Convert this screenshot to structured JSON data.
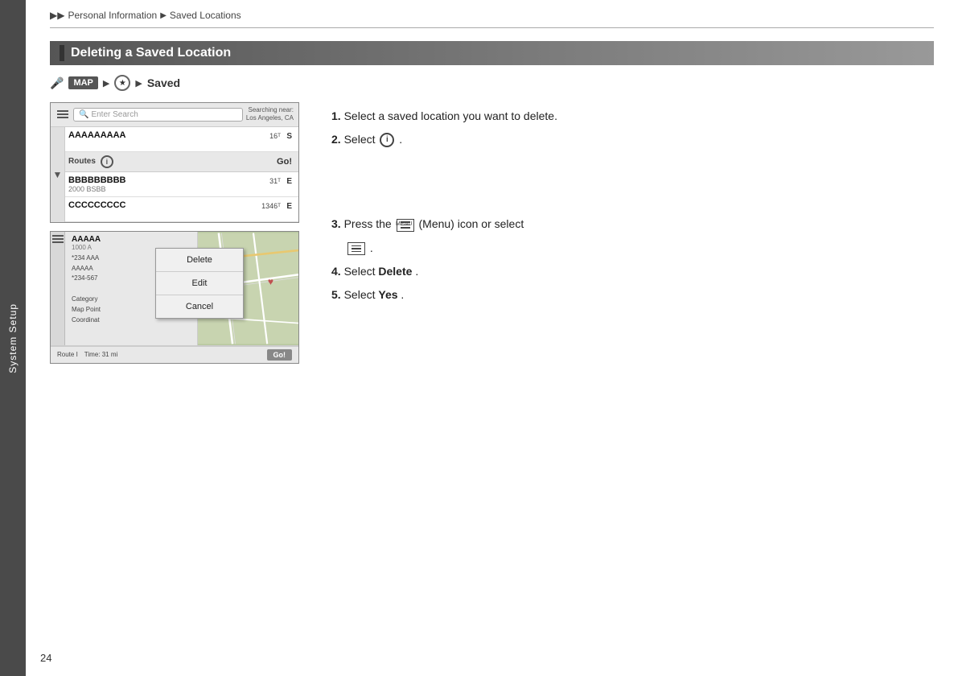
{
  "sidebar": {
    "label": "System Setup"
  },
  "breadcrumb": {
    "items": [
      "Personal Information",
      "Saved Locations"
    ],
    "arrows": [
      "▶▶",
      "▶"
    ]
  },
  "section": {
    "title": "Deleting a Saved Location"
  },
  "path": {
    "mic": "🎤",
    "map_badge": "MAP",
    "star_label": "★",
    "saved_label": "Saved"
  },
  "screen1": {
    "search_placeholder": "Enter Search",
    "searching_near_line1": "Searching near:",
    "searching_near_line2": "Los Angeles, CA",
    "items": [
      {
        "name": "AAAAAAAAA",
        "sub": "",
        "dist": "16ᵀ",
        "type": "S"
      },
      {
        "name": "BBBBBBBBB",
        "sub": "2000 BSBB",
        "dist": "31ᵀ",
        "type": "E"
      },
      {
        "name": "CCCCCCCCC",
        "sub": "",
        "dist": "1346ᵀ",
        "type": "E"
      }
    ],
    "routes_label": "Routes",
    "go_label": "Go!"
  },
  "screen2": {
    "item_name": "AAAAA",
    "item_sub": "1000 A",
    "fields": [
      "*234 AAA",
      "AAAAA",
      "*234-567",
      "",
      "Category",
      "Map Point",
      "Coordinat"
    ],
    "route_info": "Route I",
    "time_info": "Time: 31 mi",
    "go_label": "Go!",
    "overlay": {
      "delete_label": "Delete",
      "edit_label": "Edit",
      "cancel_label": "Cancel"
    }
  },
  "instructions": {
    "steps": [
      {
        "num": "1.",
        "text": "Select a saved location you want to delete."
      },
      {
        "num": "2.",
        "text": "Select",
        "has_info_icon": true
      },
      {
        "num": "3.",
        "text": "Press the",
        "has_menu_icon": true,
        "text2": "(Menu) icon or select",
        "has_menu_icon2": true
      },
      {
        "num": "4.",
        "text": "Select",
        "bold_word": "Delete",
        "period": "."
      },
      {
        "num": "5.",
        "text": "Select",
        "bold_word": "Yes",
        "period": "."
      }
    ]
  },
  "page_number": "24"
}
